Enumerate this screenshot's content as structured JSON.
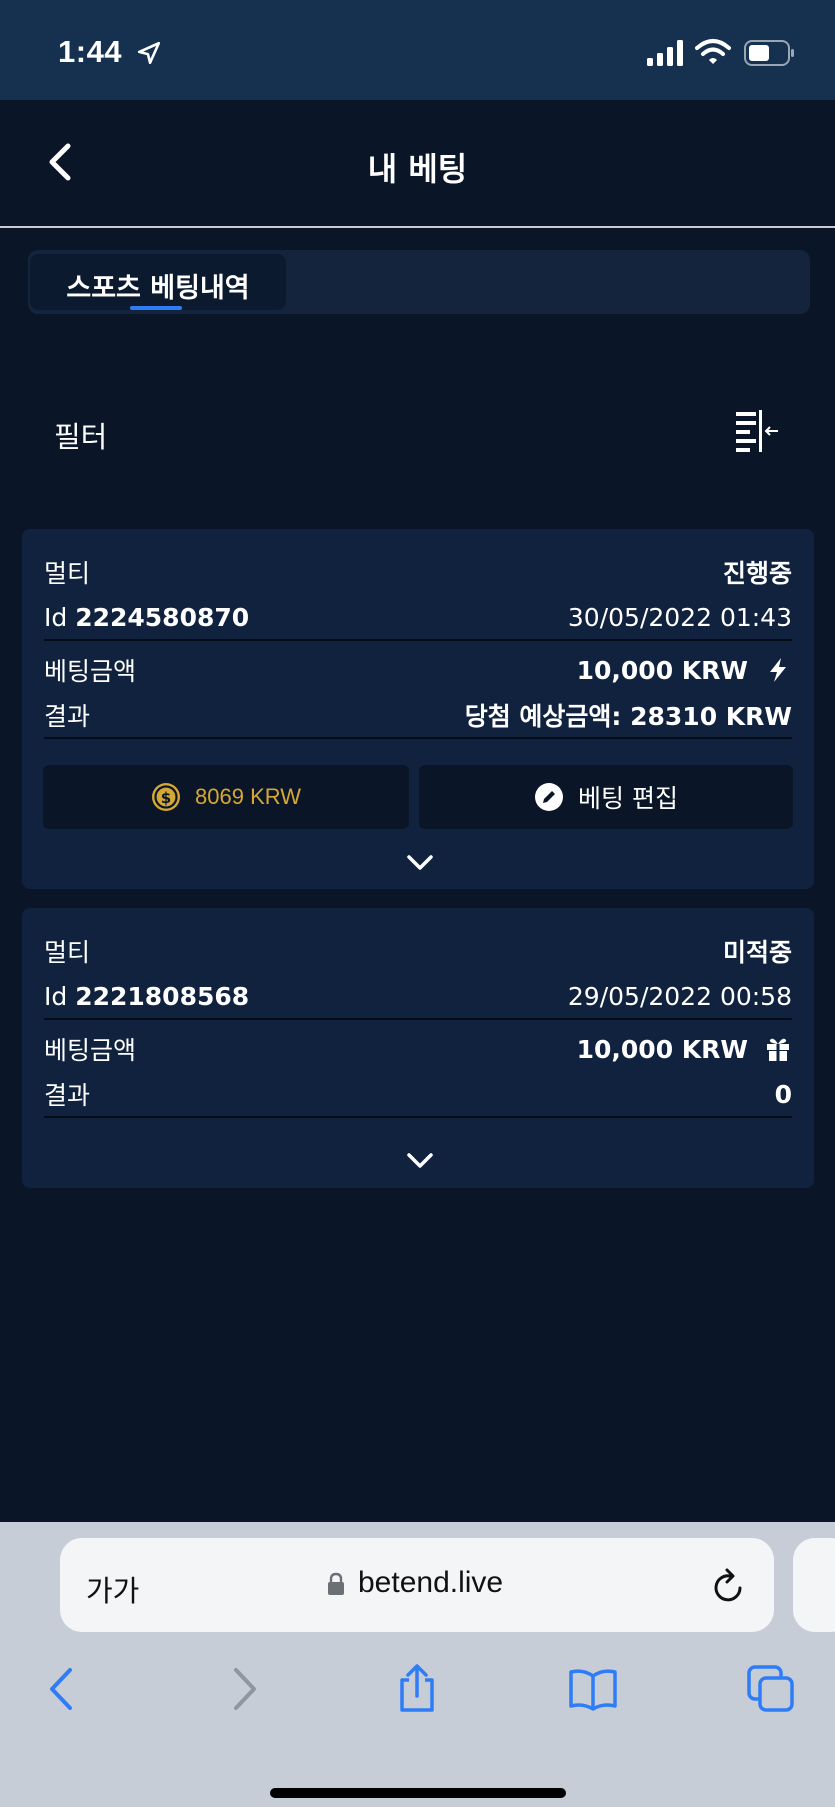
{
  "status_bar": {
    "time": "1:44"
  },
  "header": {
    "title": "내 베팅"
  },
  "tabs": [
    {
      "label": "스포츠 베팅내역"
    }
  ],
  "filter": {
    "label": "필터"
  },
  "bets": [
    {
      "type": "멀티",
      "status": "진행중",
      "id_prefix": "Id",
      "id": "2224580870",
      "date": "30/05/2022 01:43",
      "amount_label": "베팅금액",
      "amount": "10,000 KRW",
      "result_label": "결과",
      "result": "당첨 예상금액: 28310 KRW",
      "cashout_amount": "8069",
      "cashout_currency": "KRW",
      "edit_label": "베팅 편집"
    },
    {
      "type": "멀티",
      "status": "미적중",
      "id_prefix": "Id",
      "id": "2221808568",
      "date": "29/05/2022 00:58",
      "amount_label": "베팅금액",
      "amount": "10,000 KRW",
      "result_label": "결과",
      "result": "0"
    }
  ],
  "browser": {
    "text_size": "가가",
    "url": "betend.live"
  },
  "colors": {
    "accent": "#2f7df6",
    "lost": "#e35a3b",
    "coin": "#d5a833",
    "card": "#10223d",
    "background": "#0a1628"
  }
}
